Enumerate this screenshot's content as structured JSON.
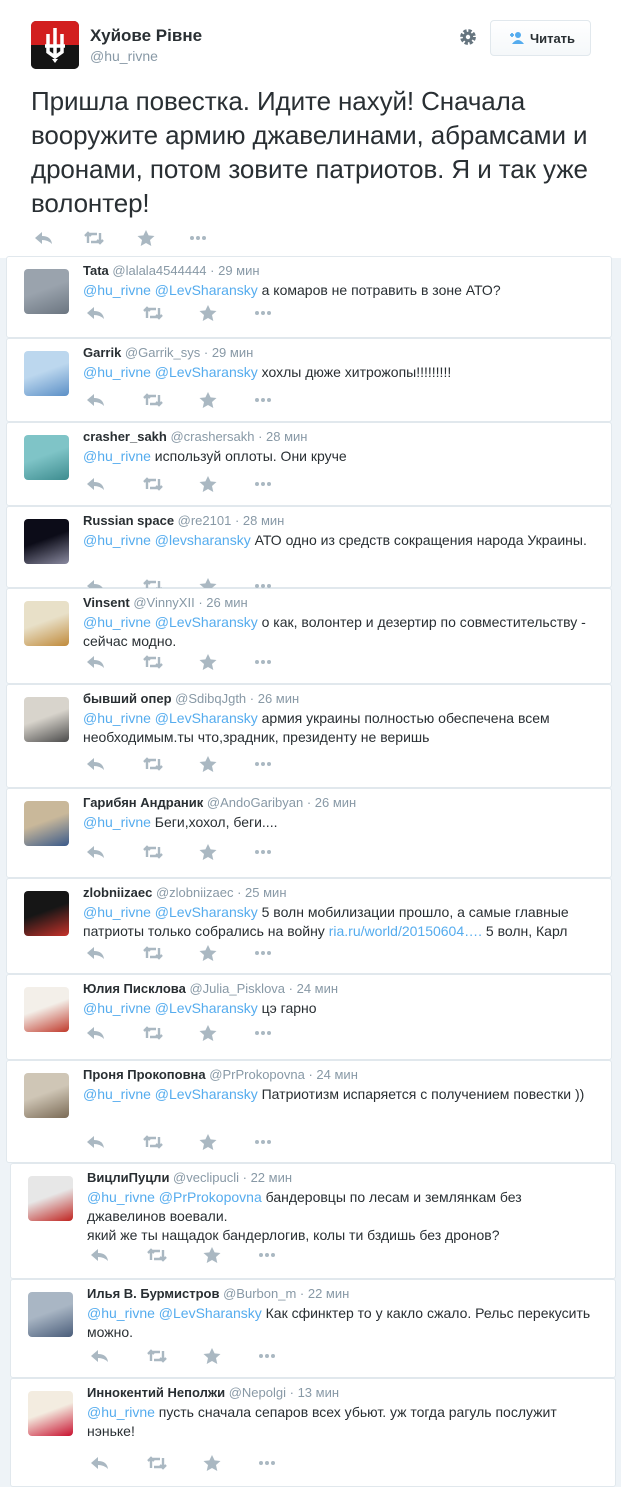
{
  "main": {
    "name": "Хуйове Рівне",
    "handle": "@hu_rivne",
    "follow_label": "Читать",
    "text": "Пришла повестка. Идите нахуй! Сначала вооружите армию джавелинами, абрамсами и дронами, потом зовите патриотов. Я и так уже волонтер!"
  },
  "icons": {
    "settings": "gear-icon",
    "follow": "add-user-icon",
    "reply": "reply-icon",
    "retweet": "retweet-icon",
    "favorite": "star-icon",
    "more": "more-icon"
  },
  "colors": {
    "link": "#55acee",
    "icon": "#aab8c2",
    "border": "#e1e8ed"
  },
  "replies": [
    {
      "name": "Tata",
      "handle": "@lalala4544444",
      "time": "29 мин",
      "mentions": "@hu_rivne @LevSharansky",
      "text": " а комаров не потравить в зоне АТО?"
    },
    {
      "name": "Garrik",
      "handle": "@Garrik_sys",
      "time": "29 мин",
      "mentions": "@hu_rivne @LevSharansky",
      "text": " хохлы дюже хитрожопы!!!!!!!!!"
    },
    {
      "name": "crasher_sakh",
      "handle": "@crashersakh",
      "time": "28 мин",
      "mentions": "@hu_rivne",
      "text": " используй оплоты. Они круче"
    },
    {
      "name": "Russian space",
      "handle": "@re2101",
      "time": "28 мин",
      "mentions": "@hu_rivne @levsharansky",
      "text": " АТО одно из средств сокращения народа Украины."
    },
    {
      "name": "Vinsent",
      "handle": "@VinnyXII",
      "time": "26 мин",
      "mentions": "@hu_rivne @LevSharansky",
      "text": " о как, волонтер и дезертир по совместительству - сейчас модно."
    },
    {
      "name": "бывший опер",
      "handle": "@SdibqJgth",
      "time": "26 мин",
      "mentions": "@hu_rivne @LevSharansky",
      "text": " армия украины полностью обеспечена всем необходимым.ты что,зрадник, президенту не веришь"
    },
    {
      "name": "Гарибян Андраник",
      "handle": "@AndoGaribyan",
      "time": "26 мин",
      "mentions": "@hu_rivne",
      "text": " Беги,хохол, беги...."
    },
    {
      "name": "zlobniizaec",
      "handle": "@zlobniizaec",
      "time": "25 мин",
      "mentions": "@hu_rivne @LevSharansky",
      "text": " 5 волн мобилизации прошло, а самые главные патриоты только собрались на войну ",
      "link": "ria.ru/world/20150604….",
      "text2": " 5 волн, Карл"
    },
    {
      "name": "Юлия Писклова",
      "handle": "@Julia_Pisklova",
      "time": "24 мин",
      "mentions": "@hu_rivne @LevSharansky",
      "text": " цэ гарно"
    },
    {
      "name": "Проня Прокоповна",
      "handle": "@PrProkopovna",
      "time": "24 мин",
      "mentions": "@hu_rivne @LevSharansky",
      "text": " Патриотизм испаряется с получением повестки ))"
    },
    {
      "name": "ВицлиПуцли",
      "handle": "@veclipucli",
      "time": "22 мин",
      "mentions": "@hu_rivne @PrProkopovna",
      "text": " бандеровцы по лесам и землянкам без джавелинов воевали.",
      "line2": "який же ты нащадок бандерлогив, колы ти бздишь без дронов?"
    },
    {
      "name": "Илья В. Бурмистров",
      "handle": "@Burbon_m",
      "time": "22 мин",
      "mentions": "@hu_rivne @LevSharansky",
      "text": " Как сфинктер то у какло сжало. Рельс перекусить можно."
    },
    {
      "name": "Иннокентий Неполжи",
      "handle": "@Nepolgi",
      "time": "13 мин",
      "mentions": "@hu_rivne",
      "text": " пусть сначала сепаров всех убьют. уж тогда рагуль послужит нэньке!"
    }
  ]
}
